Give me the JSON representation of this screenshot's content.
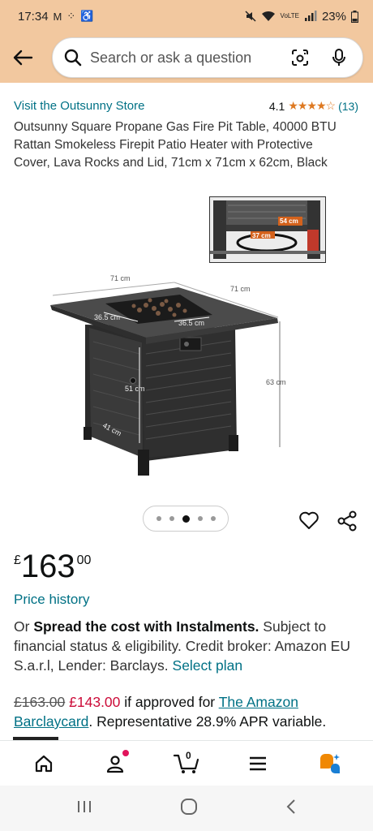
{
  "status_bar": {
    "time": "17:34",
    "battery": "23%"
  },
  "search": {
    "placeholder": "Search or ask a question"
  },
  "product": {
    "store_link": "Visit the Outsunny Store",
    "rating_value": "4.1",
    "rating_stars": 4.1,
    "rating_count": "(13)",
    "title": "Outsunny Square Propane Gas Fire Pit Table, 40000 BTU Rattan Smokeless Firepit Patio Heater with Protective Cover, Lava Rocks and Lid, 71cm x 71cm x 62cm, Black"
  },
  "image": {
    "dimensions": {
      "top_left": "71 cm",
      "top_right": "71 cm",
      "inner_left": "36.5 cm",
      "inner_right": "36.5 cm",
      "height_outer": "63 cm",
      "height_inner": "51 cm",
      "depth": "41 cm",
      "inset_top": "54 cm",
      "inset_bottom": "37 cm"
    },
    "dots_total": 5,
    "dots_active_index": 2
  },
  "price": {
    "currency": "£",
    "whole": "163",
    "fraction": "00"
  },
  "price_history": "Price history",
  "instalments": {
    "prefix": "Or ",
    "bold": "Spread the cost with Instalments.",
    "body": " Subject to financial status & eligibility. Credit broker: Amazon EU S.a.r.l, Lender: Barclays. ",
    "link": "Select plan"
  },
  "offer": {
    "old_price": "£163.00",
    "new_price": "£143.00",
    "text1": " if approved for ",
    "link1": "The Amazon",
    "link2": "Barclaycard",
    "text2": ". Representative 28.9% APR variable."
  },
  "bottom_nav": {
    "cart_count": "0"
  },
  "colors": {
    "header_bg": "#f2c89f",
    "link": "#007185",
    "star": "#de7921",
    "sale": "#cc0c39"
  }
}
